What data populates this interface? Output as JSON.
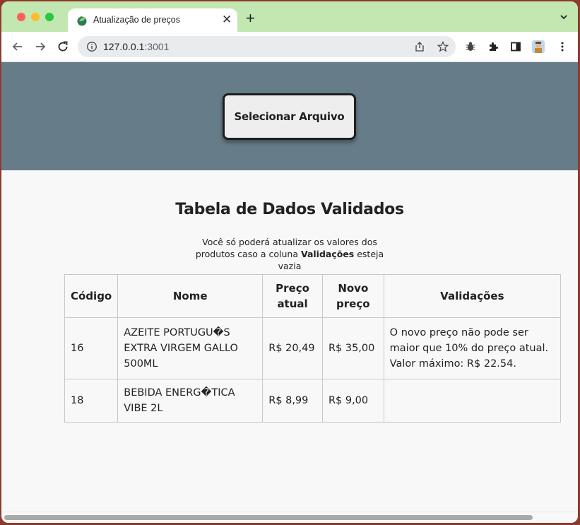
{
  "browser": {
    "tab_title": "Atualização de preços",
    "tab_close": "✕",
    "new_tab": "+",
    "url_host": "127.0.0.1",
    "url_port": ":3001"
  },
  "page": {
    "select_button": "Selecionar Arquivo",
    "heading": "Tabela de Dados Validados",
    "note_part1": "Você só poderá atualizar os valores dos produtos caso a coluna ",
    "note_bold": "Validações",
    "note_part2": " esteja vazia"
  },
  "table": {
    "headers": {
      "codigo": "Código",
      "nome": "Nome",
      "preco_atual": "Preço atual",
      "novo_preco": "Novo preço",
      "validacoes": "Validações"
    },
    "rows": [
      {
        "codigo": "16",
        "nome": "AZEITE PORTUGU�S EXTRA VIRGEM GALLO 500ML",
        "preco_atual": "R$ 20,49",
        "novo_preco": "R$ 35,00",
        "validacoes": "O novo preço não pode ser maior que 10% do preço atual. Valor máximo: R$ 22.54."
      },
      {
        "codigo": "18",
        "nome": "BEBIDA ENERG�TICA VIBE 2L",
        "preco_atual": "R$ 8,99",
        "novo_preco": "R$ 9,00",
        "validacoes": ""
      }
    ]
  },
  "colors": {
    "tabstrip": "#c2e7b1",
    "hero": "#667c89",
    "page_bg": "#f8f8f8"
  }
}
